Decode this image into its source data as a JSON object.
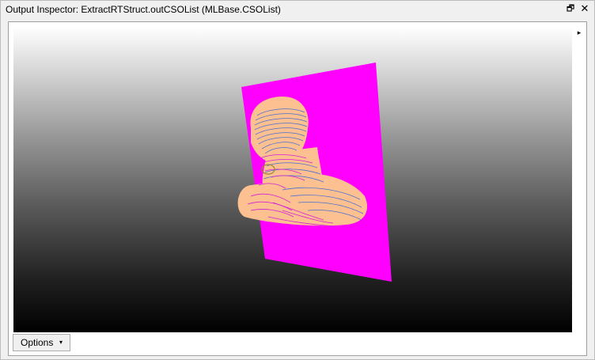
{
  "window": {
    "title": "Output Inspector: ExtractRTStruct.outCSOList (MLBase.CSOList)",
    "restore_glyph": "🗗",
    "close_glyph": "✕"
  },
  "viewer": {
    "expand_glyph": "▸",
    "colors": {
      "plane": "#ff00ff",
      "skin": "#fdc191",
      "contour_blue": "#4a6fd0",
      "contour_magenta": "#d61fd6"
    }
  },
  "toolbar": {
    "options_label": "Options",
    "options_caret": "▾"
  }
}
